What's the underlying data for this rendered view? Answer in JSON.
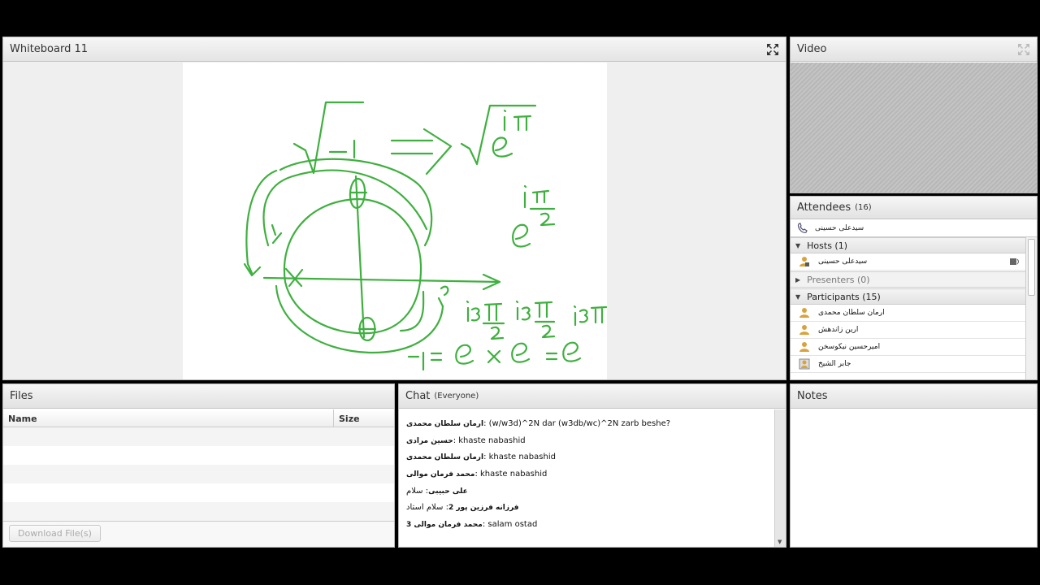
{
  "whiteboard": {
    "title": "Whiteboard 11"
  },
  "video": {
    "title": "Video"
  },
  "attendees": {
    "title": "Attendees",
    "count": "(16)",
    "me": "سیدعلی حسینی",
    "groups": {
      "hosts": {
        "label": "Hosts (1)",
        "members": [
          "سیدعلی حسینی"
        ]
      },
      "presenters": {
        "label": "Presenters (0)"
      },
      "participants": {
        "label": "Participants (15)",
        "members": [
          "ارمان سلطان محمدی",
          "ارین زاندهش",
          "امیرحسین نیکوسخن",
          "جابر الشیخ"
        ]
      }
    }
  },
  "files": {
    "title": "Files",
    "columns": {
      "name": "Name",
      "size": "Size"
    },
    "download_label": "Download File(s)"
  },
  "chat": {
    "title": "Chat",
    "scope": "(Everyone)",
    "messages": [
      {
        "who": "ارمان سلطان محمدی",
        "text": ": (w/w3d)^2N dar (w3db/wc)^2N zarb beshe?"
      },
      {
        "who": "حسین مرادی",
        "text": ": khaste nabashid"
      },
      {
        "who": "ارمان سلطان محمدی",
        "text": ": khaste nabashid"
      },
      {
        "who": "محمد فرمان موالی",
        "text": ": khaste nabashid"
      },
      {
        "who": "علی حبیبی",
        "text": ": سلام"
      },
      {
        "who": "فرزانه فرزین پور 2",
        "text": ": سلام استاد"
      },
      {
        "who": "محمد فرمان موالی 3",
        "text": ": salam ostad"
      }
    ]
  },
  "notes": {
    "title": "Notes"
  },
  "colors": {
    "ink": "#3fb03f",
    "chrome": "#e6e6e6",
    "outer": "#000000"
  },
  "icons": [
    "fullscreen-icon",
    "phone-icon",
    "speaker-icon",
    "user-icon",
    "presenter-icon"
  ]
}
